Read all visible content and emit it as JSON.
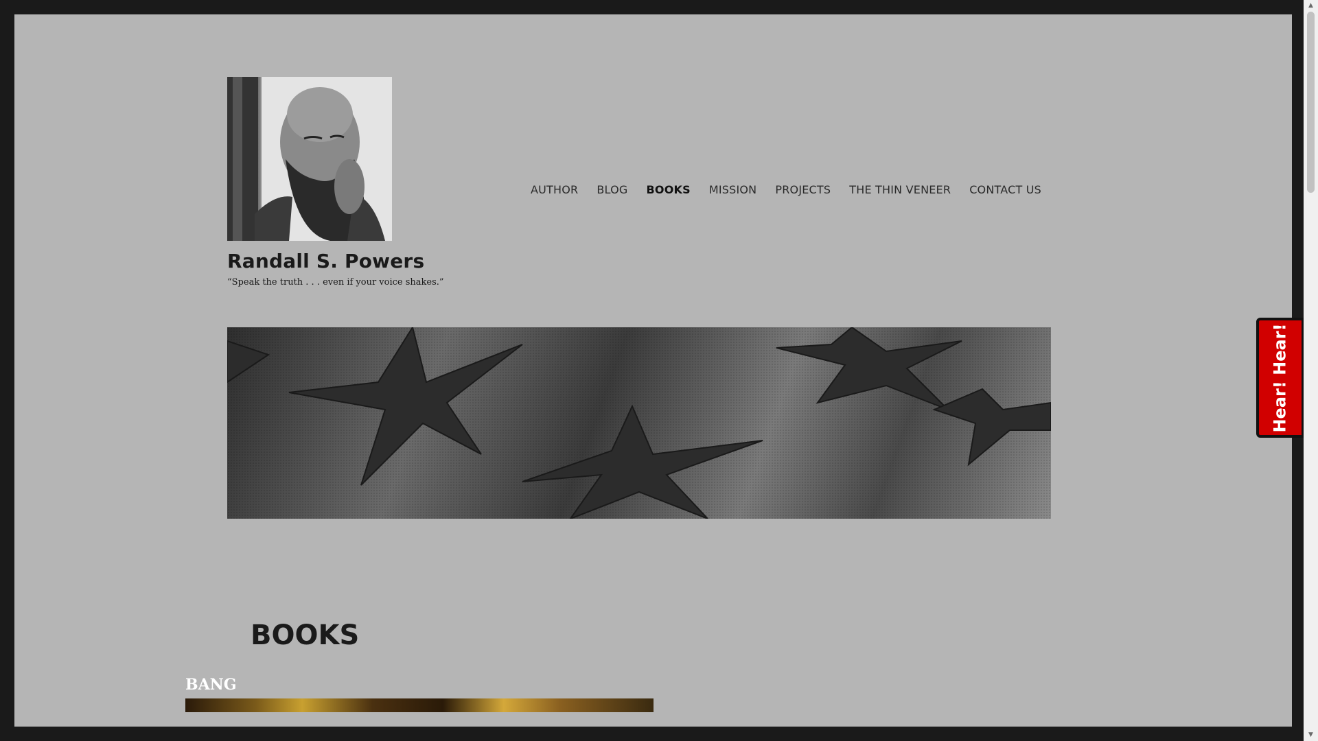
{
  "site": {
    "title": "Randall S. Powers",
    "tagline": "“Speak the truth . . . even if your voice shakes.”"
  },
  "nav": {
    "items": [
      {
        "label": "AUTHOR",
        "active": false
      },
      {
        "label": "BLOG",
        "active": false
      },
      {
        "label": "BOOKS",
        "active": true
      },
      {
        "label": "MISSION",
        "active": false
      },
      {
        "label": "PROJECTS",
        "active": false
      },
      {
        "label": "THE THIN VENEER",
        "active": false
      },
      {
        "label": "CONTACT US",
        "active": false
      }
    ]
  },
  "main": {
    "heading": "BOOKS",
    "book_title": "BANG"
  },
  "widget": {
    "label": "Hear! Hear!",
    "color": "#d10000"
  },
  "scrollbar": {
    "up_glyph": "▲",
    "down_glyph": "▼"
  }
}
